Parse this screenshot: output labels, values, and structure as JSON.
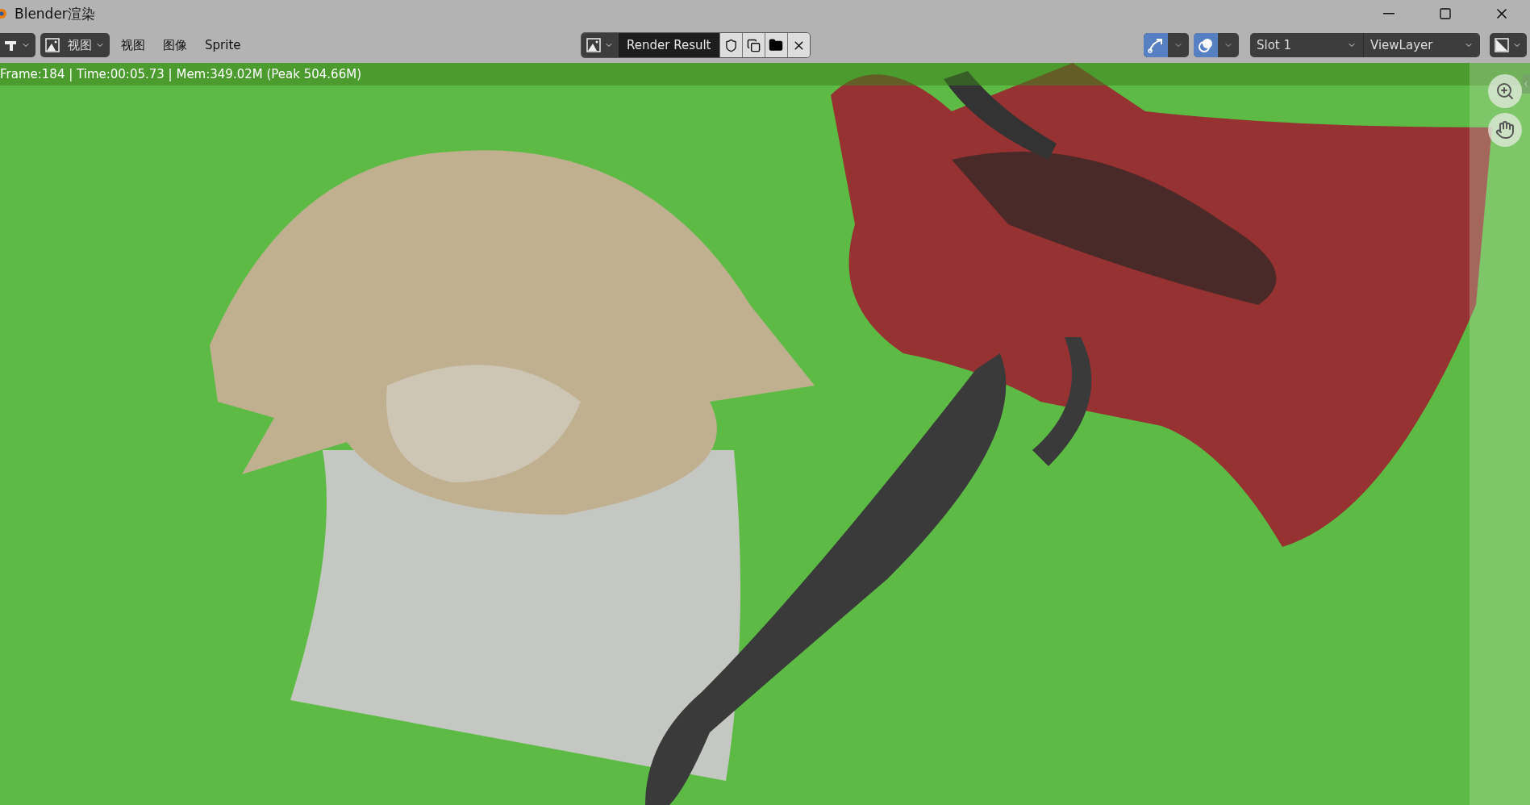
{
  "window": {
    "title": "Blender渲染"
  },
  "header": {
    "editor_menu": "视图",
    "menus": [
      "视图",
      "图像",
      "Sprite"
    ],
    "image_name": "Render Result",
    "toggles": [
      {
        "kind": "gizmo",
        "selected": true
      },
      {
        "kind": "overlay",
        "selected": true
      }
    ],
    "slot": "Slot 1",
    "view_layer": "ViewLayer"
  },
  "status": {
    "text": "Frame:184 | Time:00:05.73 | Mem:349.02M (Peak 504.66M)"
  }
}
